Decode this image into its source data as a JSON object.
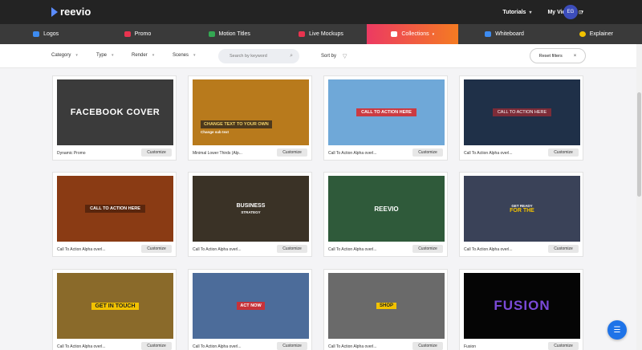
{
  "brand": {
    "logo_text": "reevio"
  },
  "topnav": {
    "tutorials": "Tutorials",
    "my_videos": "My Videos",
    "avatar": "EG"
  },
  "categories": [
    {
      "label": "Logos",
      "color": "#3d8bf0",
      "active": false
    },
    {
      "label": "Promo",
      "color": "#e8334f",
      "active": false
    },
    {
      "label": "Motion Titles",
      "color": "#34a853",
      "active": false
    },
    {
      "label": "Live Mockups",
      "color": "#e8334f",
      "active": false
    },
    {
      "label": "Collections",
      "color": "#ffffff",
      "active": true
    },
    {
      "label": "Whiteboard",
      "color": "#3d8bf0",
      "active": false
    },
    {
      "label": "Explainer",
      "color": "#f2c200",
      "active": false
    }
  ],
  "filters": {
    "category": "Category",
    "type": "Type",
    "render": "Render",
    "scenes": "Scenes",
    "search_placeholder": "Search by keyword",
    "sort_by": "Sort by",
    "reset": "Reset filters"
  },
  "customize_label": "Customize",
  "templates": [
    {
      "title": "Dynamic Promo",
      "overlay": "FACEBOOK COVER",
      "sub": "",
      "bg": "#4a4a4a"
    },
    {
      "title": "Minimal Lower Thirds (Alp...",
      "overlay": "CHANGE TEXT TO YOUR OWN",
      "sub": "Change sub text",
      "bg": "#b87a1c"
    },
    {
      "title": "Call To Action Alpha overl...",
      "overlay": "CALL TO ACTION HERE",
      "sub": "",
      "bg": "#6fa8d8"
    },
    {
      "title": "Call To Action Alpha overl...",
      "overlay": "CALL TO ACTION HERE",
      "sub": "",
      "bg": "#1f3048"
    },
    {
      "title": "Call To Action Alpha overl...",
      "overlay": "CALL TO ACTION HERE",
      "sub": "",
      "bg": "#8a3b14"
    },
    {
      "title": "Call To Action Alpha overl...",
      "overlay": "BUSINESS",
      "sub": "STRATEGY",
      "bg": "#3a3226"
    },
    {
      "title": "Call To Action Alpha overl...",
      "overlay": "REEVIO",
      "sub": "",
      "bg": "#2f5a3a"
    },
    {
      "title": "Call To Action Alpha overl...",
      "overlay": "FOR THE",
      "sub": "GET READY",
      "bg": "#3a4258"
    },
    {
      "title": "Call To Action Alpha overl...",
      "overlay": "GET IN TOUCH",
      "sub": "",
      "bg": "#8a6a2a"
    },
    {
      "title": "Call To Action Alpha overl...",
      "overlay": "ACT NOW",
      "sub": "",
      "bg": "#4c6c9a"
    },
    {
      "title": "Call To Action Alpha overl...",
      "overlay": "SHOP",
      "sub": "",
      "bg": "#6a6a6a"
    },
    {
      "title": "Fusion",
      "overlay": "FUSION",
      "sub": "",
      "bg": "#050505"
    }
  ]
}
